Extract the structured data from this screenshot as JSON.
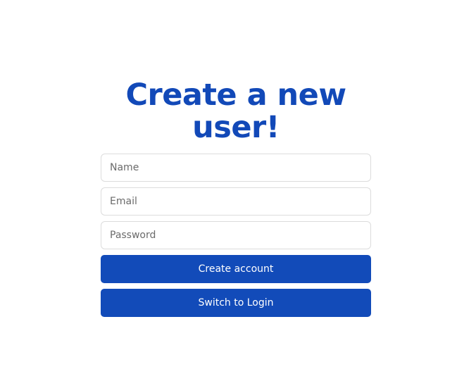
{
  "form": {
    "title": "Create a new user!",
    "name_placeholder": "Name",
    "email_placeholder": "Email",
    "password_placeholder": "Password",
    "submit_label": "Create account",
    "switch_label": "Switch to Login"
  },
  "colors": {
    "accent": "#124bb9",
    "title": "#1249b8",
    "field_border": "#dcdcdc",
    "background": "#ffffff"
  }
}
